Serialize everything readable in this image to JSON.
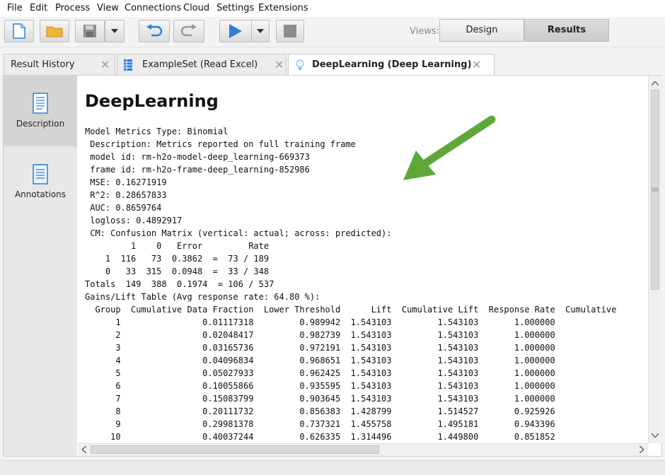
{
  "menu": [
    "File",
    "Edit",
    "Process",
    "View",
    "Connections",
    "Cloud",
    "Settings",
    "Extensions"
  ],
  "views": {
    "label": "Views:",
    "design": "Design",
    "results": "Results"
  },
  "tabs": [
    {
      "label": "Result History"
    },
    {
      "label": "ExampleSet (Read Excel)"
    },
    {
      "label": "DeepLearning (Deep Learning)"
    }
  ],
  "close_glyph": "✕",
  "sidebar": {
    "description": "Description",
    "annotations": "Annotations"
  },
  "content": {
    "title": "DeepLearning",
    "text": "Model Metrics Type: Binomial\n Description: Metrics reported on full training frame\n model id: rm-h2o-model-deep_learning-669373\n frame id: rm-h2o-frame-deep_learning-852986\n MSE: 0.16271919\n R^2: 0.28657833\n AUC: 0.8659764\n logloss: 0.4892917\n CM: Confusion Matrix (vertical: actual; across: predicted):\n         1    0   Error         Rate\n    1  116   73  0.3862  =  73 / 189\n    0   33  315  0.0948  =  33 / 348\nTotals  149  388  0.1974  = 106 / 537\nGains/Lift Table (Avg response rate: 64.80 %):\n  Group  Cumulative Data Fraction  Lower Threshold      Lift  Cumulative Lift  Response Rate  Cumulative\n      1                0.01117318         0.989942  1.543103         1.543103       1.000000\n      2                0.02048417         0.982739  1.543103         1.543103       1.000000\n      3                0.03165736         0.972191  1.543103         1.543103       1.000000\n      4                0.04096834         0.968651  1.543103         1.543103       1.000000\n      5                0.05027933         0.962425  1.543103         1.543103       1.000000\n      6                0.10055866         0.935595  1.543103         1.543103       1.000000\n      7                0.15083799         0.903645  1.543103         1.543103       1.000000\n      8                0.20111732         0.856383  1.428799         1.514527       0.925926\n      9                0.29981378         0.737321  1.455758         1.495181       0.943396\n     10                0.40037244         0.626335  1.314496         1.449800       0.851852"
  },
  "colors": {
    "accent_blue": "#2f7fd6",
    "arrow_green": "#5ea83a",
    "folder": "#f0b43a"
  }
}
